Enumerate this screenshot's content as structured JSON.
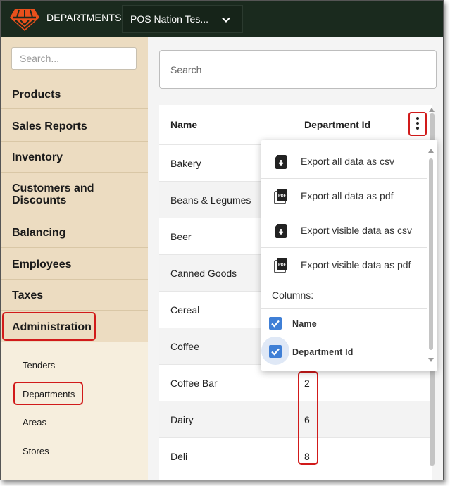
{
  "header": {
    "title": "DEPARTMENTS",
    "store_name": "POS Nation Tes...",
    "logo_icon": "store-logo-icon",
    "background": "#1a2a1e"
  },
  "sidebar": {
    "search_placeholder": "Search...",
    "items": [
      {
        "label": "Products"
      },
      {
        "label": "Sales Reports"
      },
      {
        "label": "Inventory"
      },
      {
        "label": "Customers and Discounts"
      },
      {
        "label": "Balancing"
      },
      {
        "label": "Employees"
      },
      {
        "label": "Taxes"
      },
      {
        "label": "Administration"
      }
    ],
    "subitems": [
      {
        "label": "Tenders"
      },
      {
        "label": "Departments"
      },
      {
        "label": "Areas"
      },
      {
        "label": "Stores"
      }
    ],
    "background": "#ecdcc1"
  },
  "main": {
    "search_placeholder": "Search",
    "columns": [
      "Name",
      "Department Id"
    ],
    "rows": [
      {
        "name": "Bakery",
        "id": ""
      },
      {
        "name": "Beans & Legumes",
        "id": ""
      },
      {
        "name": "Beer",
        "id": ""
      },
      {
        "name": "Canned Goods",
        "id": ""
      },
      {
        "name": "Cereal",
        "id": ""
      },
      {
        "name": "Coffee",
        "id": ""
      },
      {
        "name": "Coffee Bar",
        "id": "2"
      },
      {
        "name": "Dairy",
        "id": "6"
      },
      {
        "name": "Deli",
        "id": "8"
      }
    ]
  },
  "menu": {
    "items": [
      {
        "label": "Export all data as csv",
        "icon": "csv-file-icon"
      },
      {
        "label": "Export all data as pdf",
        "icon": "pdf-file-icon"
      },
      {
        "label": "Export visible data as csv",
        "icon": "csv-file-icon"
      },
      {
        "label": "Export visible data as pdf",
        "icon": "pdf-file-icon"
      }
    ],
    "columns_title": "Columns:",
    "column_toggles": [
      {
        "label": "Name",
        "checked": true
      },
      {
        "label": "Department Id",
        "checked": true
      }
    ]
  },
  "colors": {
    "highlight": "#d11a1a",
    "checkbox": "#3f7fd6",
    "accent": "#e8501c"
  }
}
